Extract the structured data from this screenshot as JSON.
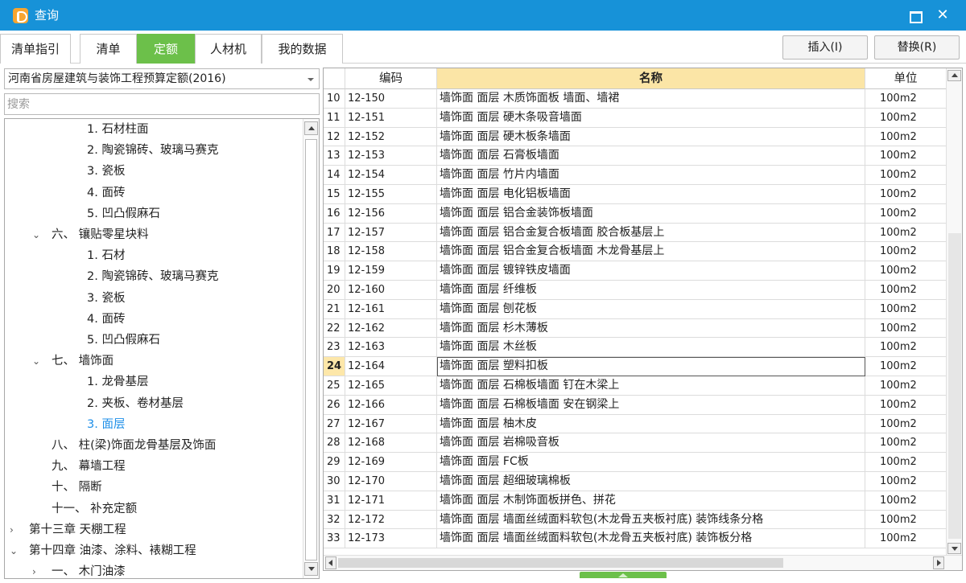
{
  "window": {
    "title": "查询"
  },
  "tabs": [
    {
      "label": "清单指引"
    },
    {
      "label": "清单"
    },
    {
      "label": "定额"
    },
    {
      "label": "人材机"
    },
    {
      "label": "我的数据"
    }
  ],
  "active_tab": "定额",
  "toolbar": {
    "insert_label": "插入(I)",
    "replace_label": "替换(R)"
  },
  "library": {
    "selected": "河南省房屋建筑与装饰工程预算定额(2016)"
  },
  "search": {
    "placeholder": "搜索"
  },
  "tree": [
    {
      "label": "1. 石材柱面",
      "indent": 3,
      "arrow": ""
    },
    {
      "label": "2. 陶瓷锦砖、玻璃马赛克",
      "indent": 3,
      "arrow": ""
    },
    {
      "label": "3. 瓷板",
      "indent": 3,
      "arrow": ""
    },
    {
      "label": "4. 面砖",
      "indent": 3,
      "arrow": ""
    },
    {
      "label": "5. 凹凸假麻石",
      "indent": 3,
      "arrow": ""
    },
    {
      "label": "六、 镶贴零星块料",
      "indent": 2,
      "arrow": "down"
    },
    {
      "label": "1. 石材",
      "indent": 3,
      "arrow": ""
    },
    {
      "label": "2. 陶瓷锦砖、玻璃马赛克",
      "indent": 3,
      "arrow": ""
    },
    {
      "label": "3. 瓷板",
      "indent": 3,
      "arrow": ""
    },
    {
      "label": "4. 面砖",
      "indent": 3,
      "arrow": ""
    },
    {
      "label": "5. 凹凸假麻石",
      "indent": 3,
      "arrow": ""
    },
    {
      "label": "七、 墙饰面",
      "indent": 2,
      "arrow": "down"
    },
    {
      "label": "1. 龙骨基层",
      "indent": 3,
      "arrow": ""
    },
    {
      "label": "2. 夹板、卷材基层",
      "indent": 3,
      "arrow": ""
    },
    {
      "label": "3. 面层",
      "indent": 3,
      "arrow": "",
      "selected": true
    },
    {
      "label": "八、 柱(梁)饰面龙骨基层及饰面",
      "indent": 2,
      "arrow": "none"
    },
    {
      "label": "九、 幕墙工程",
      "indent": 2,
      "arrow": "none"
    },
    {
      "label": "十、 隔断",
      "indent": 2,
      "arrow": "none"
    },
    {
      "label": "十一、 补充定额",
      "indent": 2,
      "arrow": "none"
    },
    {
      "label": "第十三章 天棚工程",
      "indent": 1,
      "arrow": "right"
    },
    {
      "label": "第十四章 油漆、涂料、裱糊工程",
      "indent": 1,
      "arrow": "down"
    },
    {
      "label": "一、 木门油漆",
      "indent": 2,
      "arrow": "right"
    }
  ],
  "table": {
    "headers": {
      "num": "",
      "code": "编码",
      "name": "名称",
      "unit": "单位"
    },
    "current_row": "24",
    "rows": [
      {
        "num": "10",
        "code": "12-150",
        "name": "墙饰面 面层 木质饰面板 墙面、墙裙",
        "unit": "100m2"
      },
      {
        "num": "11",
        "code": "12-151",
        "name": "墙饰面 面层 硬木条吸音墙面",
        "unit": "100m2"
      },
      {
        "num": "12",
        "code": "12-152",
        "name": "墙饰面 面层 硬木板条墙面",
        "unit": "100m2"
      },
      {
        "num": "13",
        "code": "12-153",
        "name": "墙饰面 面层 石膏板墙面",
        "unit": "100m2"
      },
      {
        "num": "14",
        "code": "12-154",
        "name": "墙饰面 面层 竹片内墙面",
        "unit": "100m2"
      },
      {
        "num": "15",
        "code": "12-155",
        "name": "墙饰面 面层 电化铝板墙面",
        "unit": "100m2"
      },
      {
        "num": "16",
        "code": "12-156",
        "name": "墙饰面 面层 铝合金装饰板墙面",
        "unit": "100m2"
      },
      {
        "num": "17",
        "code": "12-157",
        "name": "墙饰面 面层 铝合金复合板墙面 胶合板基层上",
        "unit": "100m2"
      },
      {
        "num": "18",
        "code": "12-158",
        "name": "墙饰面 面层 铝合金复合板墙面 木龙骨基层上",
        "unit": "100m2"
      },
      {
        "num": "19",
        "code": "12-159",
        "name": "墙饰面 面层 镀锌铁皮墙面",
        "unit": "100m2"
      },
      {
        "num": "20",
        "code": "12-160",
        "name": "墙饰面 面层 纤维板",
        "unit": "100m2"
      },
      {
        "num": "21",
        "code": "12-161",
        "name": "墙饰面 面层 刨花板",
        "unit": "100m2"
      },
      {
        "num": "22",
        "code": "12-162",
        "name": "墙饰面 面层 杉木薄板",
        "unit": "100m2"
      },
      {
        "num": "23",
        "code": "12-163",
        "name": "墙饰面 面层 木丝板",
        "unit": "100m2"
      },
      {
        "num": "24",
        "code": "12-164",
        "name": "墙饰面 面层 塑料扣板",
        "unit": "100m2"
      },
      {
        "num": "25",
        "code": "12-165",
        "name": "墙饰面 面层 石棉板墙面 钉在木梁上",
        "unit": "100m2"
      },
      {
        "num": "26",
        "code": "12-166",
        "name": "墙饰面 面层 石棉板墙面 安在钢梁上",
        "unit": "100m2"
      },
      {
        "num": "27",
        "code": "12-167",
        "name": "墙饰面 面层 柚木皮",
        "unit": "100m2"
      },
      {
        "num": "28",
        "code": "12-168",
        "name": "墙饰面 面层 岩棉吸音板",
        "unit": "100m2"
      },
      {
        "num": "29",
        "code": "12-169",
        "name": "墙饰面 面层 FC板",
        "unit": "100m2"
      },
      {
        "num": "30",
        "code": "12-170",
        "name": "墙饰面 面层 超细玻璃棉板",
        "unit": "100m2"
      },
      {
        "num": "31",
        "code": "12-171",
        "name": "墙饰面 面层 木制饰面板拼色、拼花",
        "unit": "100m2"
      },
      {
        "num": "32",
        "code": "12-172",
        "name": "墙饰面 面层 墙面丝绒面料软包(木龙骨五夹板衬底) 装饰线条分格",
        "unit": "100m2"
      },
      {
        "num": "33",
        "code": "12-173",
        "name": "墙饰面 面层 墙面丝绒面料软包(木龙骨五夹板衬底) 装饰板分格",
        "unit": "100m2"
      }
    ]
  },
  "colors": {
    "titlebar": "#1792d8",
    "active_tab": "#6cc04a",
    "header_highlight": "#fbe5a6",
    "selected_tree_item": "#1e8fe8"
  },
  "icons": {
    "app": "app-logo-icon",
    "maximize": "maximize-icon",
    "close": "close-icon"
  }
}
